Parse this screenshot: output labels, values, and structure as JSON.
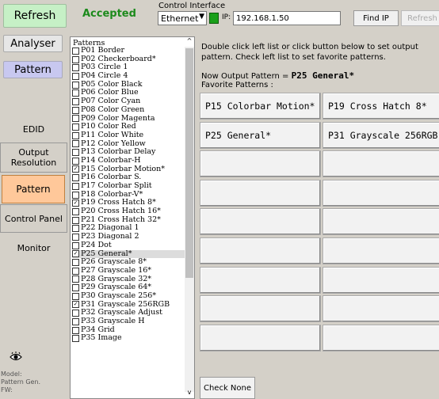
{
  "top": {
    "refresh_label": "Refresh",
    "status": "Accepted",
    "control_interface_label": "Control Interface",
    "interface_value": "Ethernet",
    "ip_label": "IP:",
    "ip_value": "192.168.1.50",
    "find_ip_label": "Find IP",
    "refresh2_label": "Refresh"
  },
  "nav_top": {
    "analyser": "Analyser",
    "pattern": "Pattern"
  },
  "side_menu": [
    {
      "label": "EDID"
    },
    {
      "label": "Output Resolution"
    },
    {
      "label": "Pattern"
    },
    {
      "label": "Control Panel"
    },
    {
      "label": "Monitor"
    }
  ],
  "model_text": "Model:",
  "pattern_gen_text": "Pattern Gen.",
  "fw_text": "FW:",
  "patterns": {
    "header": "Patterns",
    "items": [
      {
        "label": "P01 Border",
        "checked": false
      },
      {
        "label": "P02 Checkerboard*",
        "checked": false
      },
      {
        "label": "P03 Circle 1",
        "checked": false
      },
      {
        "label": "P04 Circle 4",
        "checked": false
      },
      {
        "label": "P05 Color Black",
        "checked": false
      },
      {
        "label": "P06 Color Blue",
        "checked": false
      },
      {
        "label": "P07 Color Cyan",
        "checked": false
      },
      {
        "label": "P08 Color Green",
        "checked": false
      },
      {
        "label": "P09 Color Magenta",
        "checked": false
      },
      {
        "label": "P10 Color Red",
        "checked": false
      },
      {
        "label": "P11 Color White",
        "checked": false
      },
      {
        "label": "P12 Color Yellow",
        "checked": false
      },
      {
        "label": "P13 Colorbar Delay",
        "checked": false
      },
      {
        "label": "P14 Colorbar-H",
        "checked": false
      },
      {
        "label": "P15 Colorbar Motion*",
        "checked": true
      },
      {
        "label": "P16 Colorbar S.",
        "checked": false
      },
      {
        "label": "P17 Colorbar Split",
        "checked": false
      },
      {
        "label": "P18 Colorbar-V*",
        "checked": false
      },
      {
        "label": "P19 Cross Hatch 8*",
        "checked": true
      },
      {
        "label": "P20 Cross Hatch 16*",
        "checked": false
      },
      {
        "label": "P21 Cross Hatch 32*",
        "checked": false
      },
      {
        "label": "P22 Diagonal 1",
        "checked": false
      },
      {
        "label": "P23 Diagonal 2",
        "checked": false
      },
      {
        "label": "P24 Dot",
        "checked": false
      },
      {
        "label": "P25 General*",
        "checked": true
      },
      {
        "label": "P26 Grayscale 8*",
        "checked": false
      },
      {
        "label": "P27 Grayscale 16*",
        "checked": false
      },
      {
        "label": "P28 Grayscale 32*",
        "checked": false
      },
      {
        "label": "P29 Grayscale 64*",
        "checked": false
      },
      {
        "label": "P30 Grayscale 256*",
        "checked": false
      },
      {
        "label": "P31 Grayscale 256RGB",
        "checked": true
      },
      {
        "label": "P32 Grayscale Adjust",
        "checked": false
      },
      {
        "label": "P33 Grayscale H",
        "checked": false
      },
      {
        "label": "P34 Grid",
        "checked": false
      },
      {
        "label": "P35 Image",
        "checked": false
      }
    ]
  },
  "info": {
    "instructions": "Double click left list or click button below to set output pattern. Check left list to set favorite patterns.",
    "now_output_prefix": "Now Output Pattern = ",
    "now_output_value": "P25 General*",
    "favorite_label": "Favorite Patterns :"
  },
  "favorites": [
    "P15 Colorbar Motion*",
    "P19 Cross Hatch 8*",
    "P25 General*",
    "P31 Grayscale 256RGB",
    "",
    "",
    "",
    "",
    "",
    "",
    "",
    "",
    "",
    "",
    "",
    "",
    "",
    ""
  ],
  "check_none_label": "Check None"
}
